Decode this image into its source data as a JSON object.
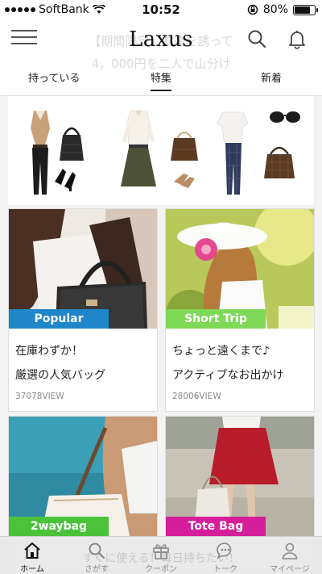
{
  "status_bar": {
    "carrier": "SoftBank",
    "time": "10:52",
    "battery": "80%",
    "battery_level": 0.8
  },
  "header": {
    "logo": "Laxus",
    "promo_line1": "【期間限定】友達を誘って",
    "promo_line2": "4，000円を二人で山分け"
  },
  "tabs": [
    {
      "label": "持っている"
    },
    {
      "label": "特集",
      "selected": true
    },
    {
      "label": "新着"
    }
  ],
  "cards": [
    {
      "tag": "Popular",
      "tag_color": "#1f86c9",
      "title1": "在庫わずか！",
      "title2": "厳選の人気バッグ",
      "views": "37078VIEW"
    },
    {
      "tag": "Short Trip",
      "tag_color": "#7ed957",
      "title1": "ちょっと遠くまで♪",
      "title2": "アクティブなお出かけ",
      "views": "28006VIEW"
    },
    {
      "tag": "2waybag",
      "tag_color": "#4bc23a"
    },
    {
      "tag": "Tote Bag",
      "tag_color": "#d61d9a"
    }
  ],
  "bottom_nav": {
    "promo": "すぐに使える！毎日持ちたい！",
    "items": [
      {
        "label": "ホーム",
        "icon": "home-icon",
        "active": true
      },
      {
        "label": "さがす",
        "icon": "search-icon"
      },
      {
        "label": "クーポン",
        "icon": "gift-icon"
      },
      {
        "label": "トーク",
        "icon": "chat-icon"
      },
      {
        "label": "マイページ",
        "icon": "person-icon"
      }
    ]
  }
}
